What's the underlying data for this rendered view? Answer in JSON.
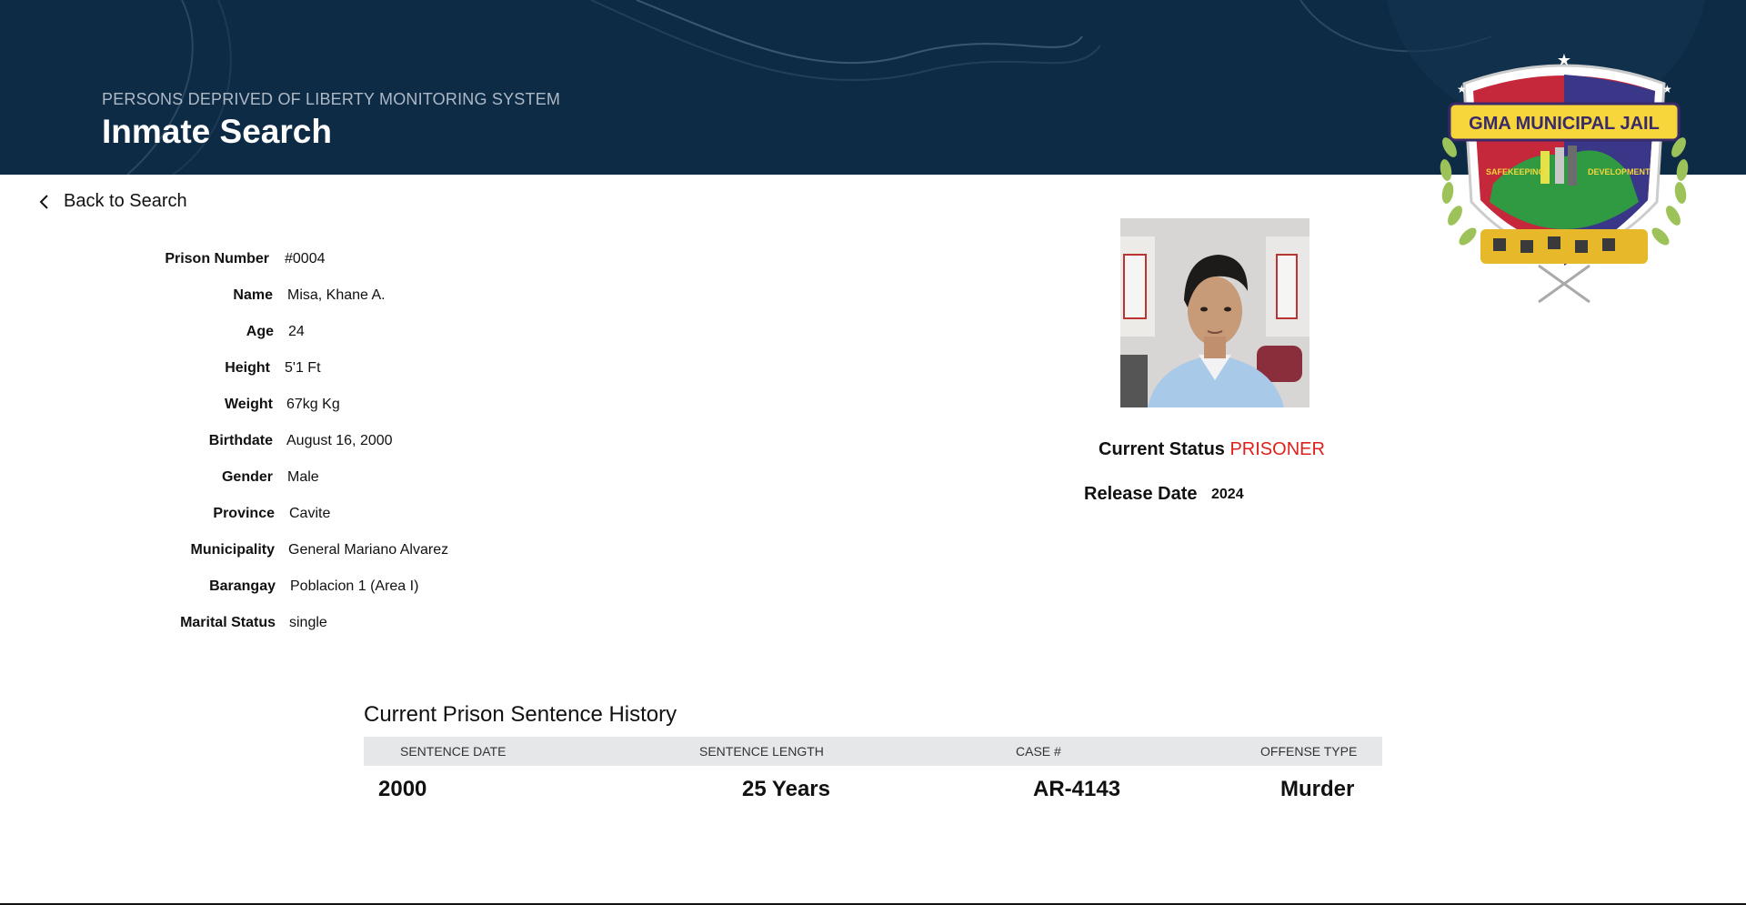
{
  "header": {
    "subtitle": "PERSONS DEPRIVED OF LIBERTY MONITORING SYSTEM",
    "title": "Inmate Search"
  },
  "logo": {
    "banner_text": "GMA MUNICIPAL JAIL",
    "left_ribbon": "SAFEKEEPING",
    "right_ribbon": "DEVELOPMENT"
  },
  "nav": {
    "back_label": "Back to Search"
  },
  "details": [
    {
      "label": "Prison Number",
      "value": "#0004"
    },
    {
      "label": "Name",
      "value": "Misa, Khane A."
    },
    {
      "label": "Age",
      "value": "24"
    },
    {
      "label": "Height",
      "value": "5'1 Ft"
    },
    {
      "label": "Weight",
      "value": "67kg Kg"
    },
    {
      "label": "Birthdate",
      "value": "August 16, 2000"
    },
    {
      "label": "Gender",
      "value": "Male"
    },
    {
      "label": "Province",
      "value": "Cavite"
    },
    {
      "label": "Municipality",
      "value": "General Mariano Alvarez"
    },
    {
      "label": "Barangay",
      "value": "Poblacion 1 (Area I)"
    },
    {
      "label": "Marital Status",
      "value": "single"
    }
  ],
  "status": {
    "label": "Current Status",
    "value": "PRISONER",
    "value_color": "#e0201d"
  },
  "release": {
    "label": "Release Date",
    "value": "2024"
  },
  "history": {
    "title": "Current Prison Sentence History",
    "columns": [
      "SENTENCE DATE",
      "SENTENCE LENGTH",
      "CASE #",
      "OFFENSE TYPE"
    ],
    "rows": [
      [
        "2000",
        "25 Years",
        "AR-4143",
        "Murder"
      ]
    ]
  },
  "colors": {
    "header_bg": "#0e2b45",
    "table_head_bg": "#e6e7e9",
    "accent_red": "#e0201d"
  }
}
